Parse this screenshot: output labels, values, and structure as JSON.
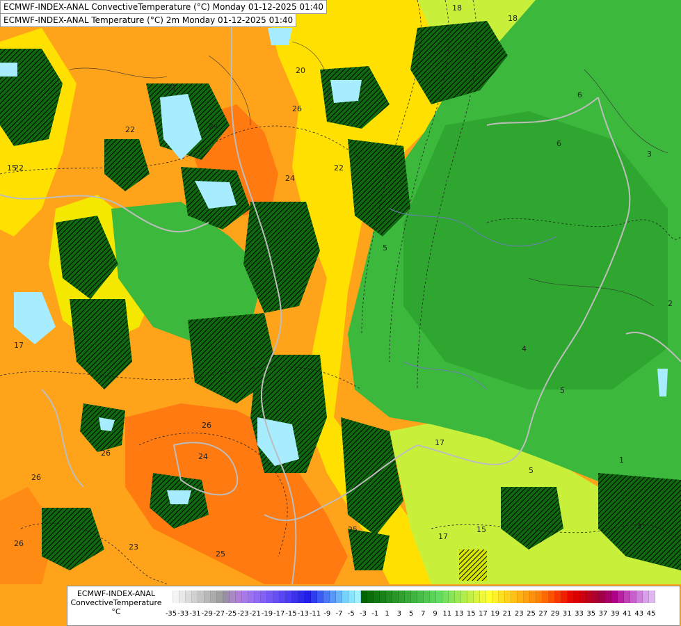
{
  "header": {
    "line1": "ECMWF-INDEX-ANAL ConvectiveTemperature (°C) Monday 01-12-2025 01:40",
    "line2": "ECMWF-INDEX-ANAL Temperature (°C) 2m Monday 01-12-2025 01:40"
  },
  "legend": {
    "title_line1": "ECMWF-INDEX-ANAL",
    "title_line2": "ConvectiveTemperature",
    "unit": "°C",
    "ticks": [
      "-35",
      "-33",
      "-31",
      "-29",
      "-27",
      "-25",
      "-23",
      "-21",
      "-19",
      "-17",
      "-15",
      "-13",
      "-11",
      "-9",
      "-7",
      "-5",
      "-3",
      "-1",
      "1",
      "3",
      "5",
      "7",
      "9",
      "11",
      "13",
      "15",
      "17",
      "19",
      "21",
      "23",
      "25",
      "27",
      "29",
      "31",
      "33",
      "35",
      "37",
      "39",
      "41",
      "43",
      "45"
    ],
    "colors": [
      "#ffffff",
      "#f4f4f4",
      "#e8e8e8",
      "#dcdcdc",
      "#d0d0d0",
      "#c4c4c4",
      "#b8b8b8",
      "#acacac",
      "#a0a0a0",
      "#9a8fa8",
      "#a98ac4",
      "#b07ed8",
      "#a87ae8",
      "#9c72f0",
      "#8f6af4",
      "#8360f6",
      "#7458f6",
      "#6650f4",
      "#5846f2",
      "#4a3cf0",
      "#3c32ee",
      "#2e28ec",
      "#201ee8",
      "#2e3cf0",
      "#3c5af4",
      "#4a78f6",
      "#5896f8",
      "#66b4fa",
      "#74d2fc",
      "#86e4fe",
      "#a0f0ff",
      "#006400",
      "#086e08",
      "#107810",
      "#188218",
      "#208c20",
      "#289628",
      "#30a030",
      "#38aa38",
      "#40b440",
      "#48be48",
      "#50c850",
      "#58d258",
      "#60dc60",
      "#74e05c",
      "#88e456",
      "#9ce850",
      "#b0ec4a",
      "#c4f044",
      "#d8f43e",
      "#ecf838",
      "#ffff30",
      "#fff028",
      "#ffe020",
      "#ffd01c",
      "#ffc018",
      "#ffb014",
      "#ffa010",
      "#ff900c",
      "#ff8008",
      "#ff6804",
      "#ff5000",
      "#f83800",
      "#f02000",
      "#e80800",
      "#dc0000",
      "#cc0010",
      "#bc0020",
      "#ac0030",
      "#a00048",
      "#a80068",
      "#b00088",
      "#b820a0",
      "#c040b8",
      "#c860cc",
      "#d080dc",
      "#d8a0e8",
      "#e0b8f0"
    ]
  },
  "map": {
    "contour_labels": [
      "22",
      "21",
      "24",
      "24",
      "26",
      "22",
      "20",
      "22",
      "18",
      "18",
      "17",
      "6",
      "6",
      "5",
      "4",
      "5",
      "15",
      "17",
      "25",
      "26",
      "26",
      "26",
      "24",
      "26",
      "23",
      "25",
      "5",
      "1",
      "3",
      "2",
      "3",
      "17",
      "15"
    ],
    "colors": {
      "ocean": "#101010",
      "warm_orange": "#ffa31a",
      "deep_orange": "#ff7a10",
      "yellow": "#ffe000",
      "lime": "#c8f03a",
      "green": "#3cb83c",
      "dark_green": "#0f6a0f",
      "cyan": "#a8ecff",
      "border": "#bdbdbd"
    }
  }
}
